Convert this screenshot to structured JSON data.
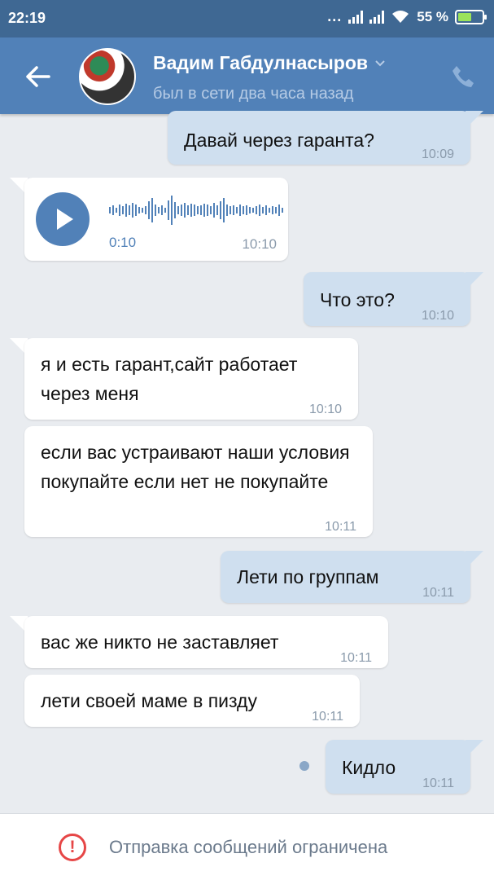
{
  "status_bar": {
    "time": "22:19",
    "dots": "...",
    "battery": "55 %"
  },
  "header": {
    "name": "Вадим Габдулнасыров",
    "status": "был в сети два часа назад"
  },
  "messages": [
    {
      "dir": "out",
      "text": "Давай через гаранта?",
      "time": "10:09"
    },
    {
      "dir": "in",
      "type": "voice",
      "duration": "0:10",
      "time": "10:10"
    },
    {
      "dir": "out",
      "text": "Что это?",
      "time": "10:10"
    },
    {
      "dir": "in",
      "text": "я и есть гарант,сайт работает через меня",
      "time": "10:10"
    },
    {
      "dir": "in",
      "text": "если вас устраивают наши условия покупайте если нет не покупайте",
      "time": "10:11"
    },
    {
      "dir": "out",
      "text": "Лети по группам",
      "time": "10:11"
    },
    {
      "dir": "in",
      "text": "вас же никто не заставляет",
      "time": "10:11"
    },
    {
      "dir": "in",
      "text": "лети своей маме в пизду",
      "time": "10:11"
    },
    {
      "dir": "out",
      "text": "Кидло",
      "time": "10:11",
      "unread": true
    }
  ],
  "footer": {
    "icon": "exclamation-circle-icon",
    "text": "Отправка сообщений ограничена"
  },
  "colors": {
    "statusbar": "#3f6893",
    "header": "#5181b8",
    "outgoing": "#cfdfef",
    "incoming": "#ffffff",
    "background": "#e9ecf0",
    "warning": "#e64646"
  }
}
